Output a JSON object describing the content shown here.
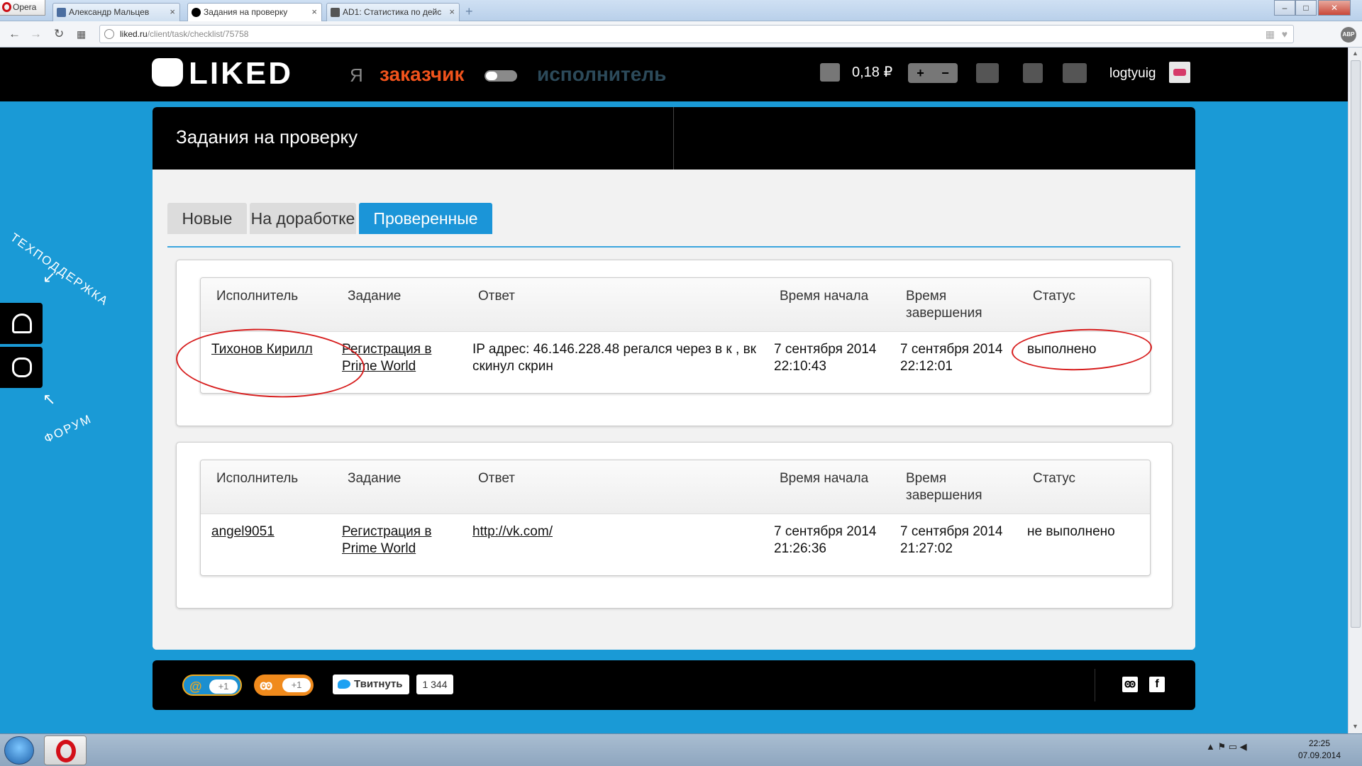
{
  "browser": {
    "opera_label": "Opera",
    "tabs": [
      {
        "title": "Александр Мальцев",
        "favicon_color": "#4b6ea0"
      },
      {
        "title": "Задания на проверку",
        "favicon_color": "#000000"
      },
      {
        "title": "AD1: Статистика по дейс",
        "favicon_color": "#555555"
      }
    ],
    "new_tab_symbol": "+",
    "url_host": "liked.ru",
    "url_path": "/client/task/checklist/75758",
    "abp_label": "ABP"
  },
  "header": {
    "logo": "LIKED",
    "role_ya": "Я",
    "role_client": "заказчик",
    "role_executor": "исполнитель",
    "balance": "0,18 ₽",
    "plus": "+",
    "minus": "−",
    "username": "logtyuig"
  },
  "panel": {
    "title": "Задания на проверку",
    "tabs": [
      {
        "label": "Новые",
        "active": false
      },
      {
        "label": "На доработке",
        "active": false
      },
      {
        "label": "Проверенные",
        "active": true
      }
    ]
  },
  "table": {
    "columns": [
      "Исполнитель",
      "Задание",
      "Ответ",
      "Время начала",
      "Время завершения",
      "Статус"
    ],
    "rows": [
      {
        "executor": "Тихонов Кирилл",
        "task": "Регистрация в Prime World",
        "answer": "IP адрес: 46.146.228.48 регался через в к , вк скинул скрин",
        "start": "7 сентября 2014 22:10:43",
        "end": "7 сентября 2014 22:12:01",
        "status": "выполнено"
      },
      {
        "executor": "angel9051",
        "task": "Регистрация в Prime World",
        "answer": "http://vk.com/",
        "start": "7 сентября 2014 21:26:36",
        "end": "7 сентября 2014 21:27:02",
        "status": "не выполнено"
      }
    ]
  },
  "side": {
    "support_label": "ТЕХПОДДЕРЖКА",
    "forum_label": "ФОРУМ"
  },
  "footer": {
    "mail_count": "+1",
    "ok_count": "+1",
    "tweet_label": "Твитнуть",
    "tweet_count": "1 344"
  },
  "taskbar": {
    "time": "22:25",
    "date": "07.09.2014"
  },
  "colors": {
    "page_bg": "#1a9ad6",
    "accent_orange": "#f0531c",
    "tab_active": "#1b95d8",
    "annotation_red": "#d71d1d"
  }
}
